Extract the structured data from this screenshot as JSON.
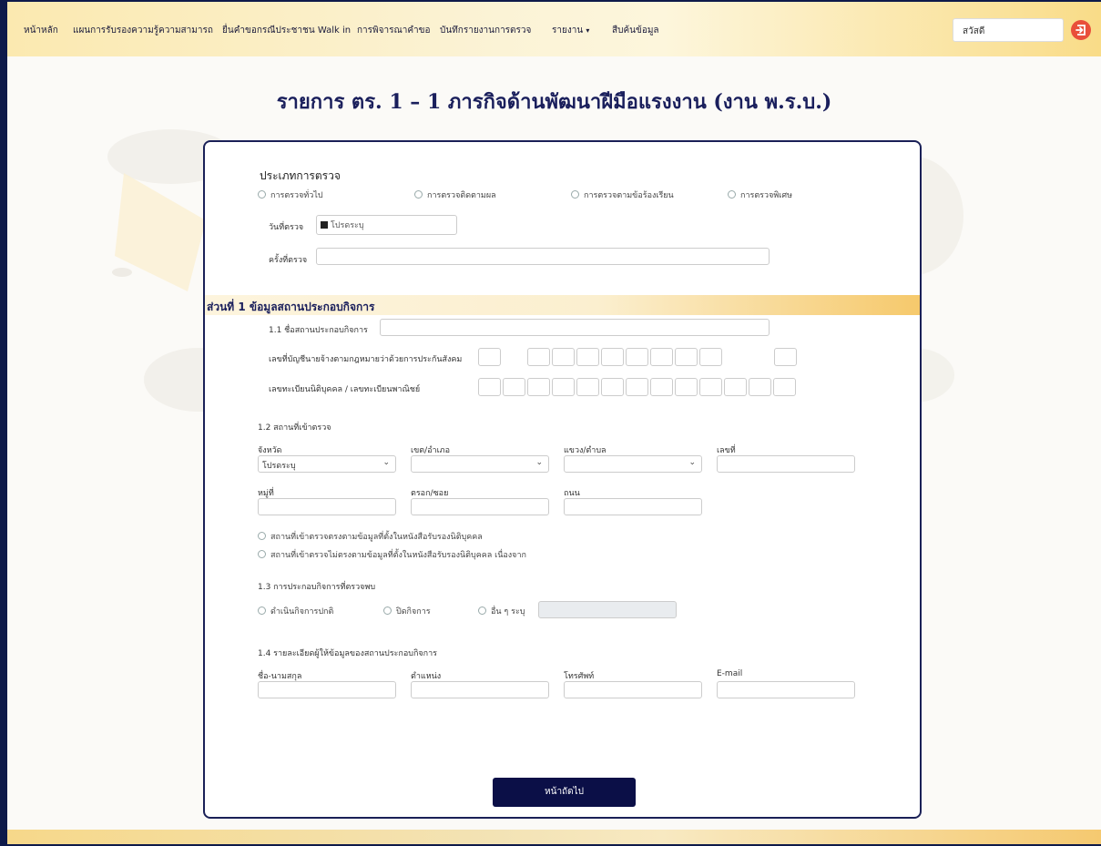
{
  "nav": {
    "items": [
      "หน้าหลัก",
      "แผนการรับรองความรู้ความสามารถ",
      "ยื่นคำขอกรณีประชาชน Walk in",
      "การพิจารณาคำขอ",
      "บันทึกรายงานการตรวจ",
      "รายงาน",
      "สืบค้นข้อมูล"
    ],
    "report_caret": "▾",
    "greeting": "สวัสดี",
    "logout_icon": "logout-icon"
  },
  "page": {
    "title": "รายการ ตร. 1 – 1 ภารกิจด้านพัฒนาฝีมือแรงงาน (งาน พ.ร.บ.)"
  },
  "inspection": {
    "type_label": "ประเภทการตรวจ",
    "types": [
      "การตรวจทั่วไป",
      "การตรวจติดตามผล",
      "การตรวจตามข้อร้องเรียน",
      "การตรวจพิเศษ"
    ],
    "date_label": "วันที่ตรวจ",
    "date_placeholder": "โปรดระบุ",
    "round_label": "ครั้งที่ตรวจ"
  },
  "section1": {
    "title": "ส่วนที่ 1 ข้อมูลสถานประกอบกิจการ",
    "name_label": "1.1 ชื่อสถานประกอบกิจการ",
    "social_security_label": "เลขที่บัญชีนายจ้างตามกฎหมายว่าด้วยการประกันสังคม",
    "registration_label": "เลขทะเบียนนิติบุคคล / เลขทะเบียนพาณิชย์",
    "location_label": "1.2 สถานที่เข้าตรวจ",
    "province_label": "จังหวัด",
    "province_value": "โปรดระบุ",
    "district_label": "เขต/อำเภอ",
    "subdistrict_label": "แขวง/ตำบล",
    "house_no_label": "เลขที่",
    "moo_label": "หมู่ที่",
    "soi_label": "ตรอก/ซอย",
    "road_label": "ถนน",
    "location_options": [
      "สถานที่เข้าตรวจตรงตามข้อมูลที่ตั้งในหนังสือรับรองนิติบุคคล",
      "สถานที่เข้าตรวจไม่ตรงตามข้อมูลที่ตั้งในหนังสือรับรองนิติบุคคล เนื่องจาก"
    ],
    "operation_label": "1.3 การประกอบกิจการที่ตรวจพบ",
    "operation_options": [
      "ดำเนินกิจการปกติ",
      "ปิดกิจการ",
      "อื่น ๆ ระบุ"
    ],
    "informant_label": "1.4 รายละเอียดผู้ให้ข้อมูลของสถานประกอบกิจการ",
    "fullname_label": "ชื่อ-นามสกุล",
    "position_label": "ตำแหน่ง",
    "phone_label": "โทรศัพท์",
    "email_label": "E-mail"
  },
  "actions": {
    "next_label": "หน้าถัดไป"
  }
}
